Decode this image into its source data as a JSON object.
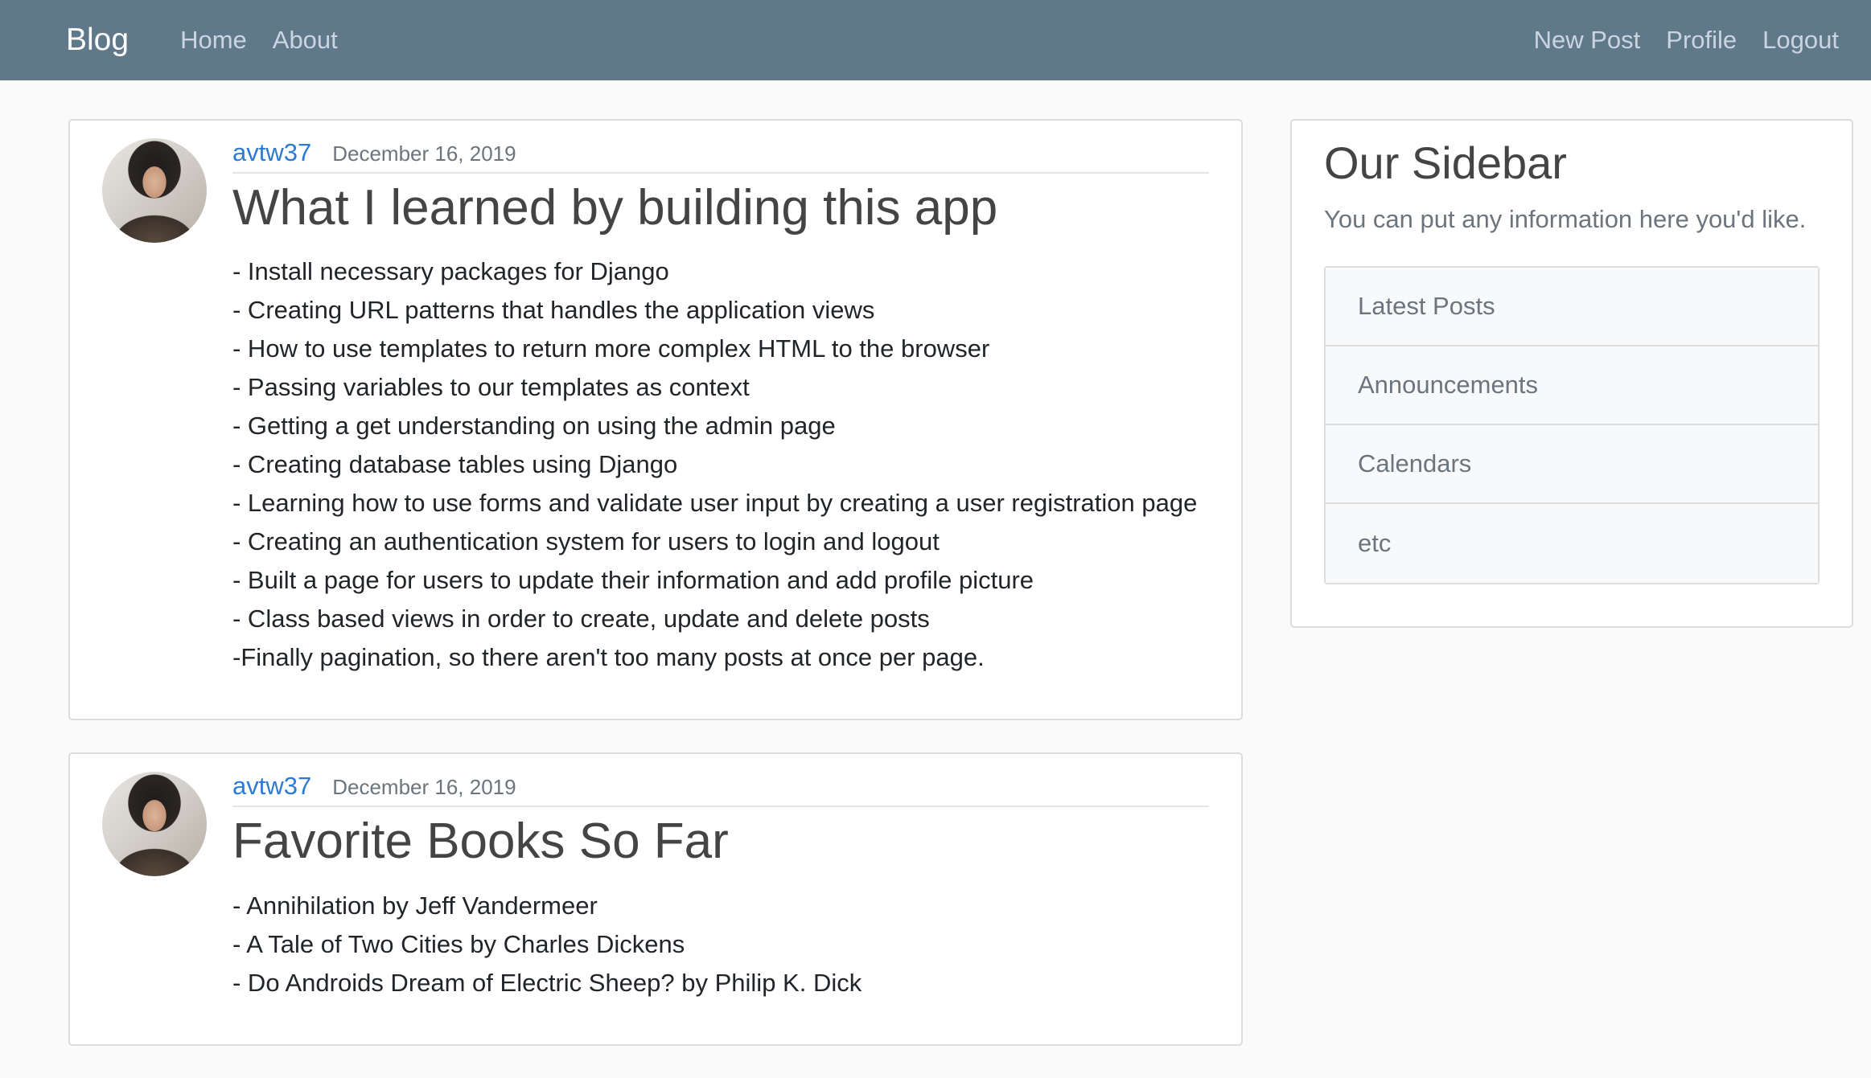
{
  "navbar": {
    "brand": "Blog",
    "left_links": [
      "Home",
      "About"
    ],
    "right_links": [
      "New Post",
      "Profile",
      "Logout"
    ],
    "background_color": "#5f788a"
  },
  "posts": [
    {
      "author": "avtw37",
      "date": "December 16, 2019",
      "title": "What I learned by building this app",
      "lines": [
        "- Install necessary packages for Django",
        "- Creating URL patterns that handles the application views",
        "- How to use templates to return more complex HTML to the browser",
        "- Passing variables to our templates as context",
        "- Getting a get understanding on using the admin page",
        "- Creating database tables using Django",
        "- Learning how to use forms and validate user input by creating a user registration page",
        "- Creating an authentication system for users to login and logout",
        "- Built a page for users to update their information and add profile picture",
        "- Class based views in order to create, update and delete posts",
        "-Finally pagination, so there aren't too many posts at once per page."
      ]
    },
    {
      "author": "avtw37",
      "date": "December 16, 2019",
      "title": "Favorite Books So Far",
      "lines": [
        "- Annihilation by Jeff Vandermeer",
        "- A Tale of Two Cities by Charles Dickens",
        "- Do Androids Dream of Electric Sheep? by Philip K. Dick"
      ]
    }
  ],
  "sidebar": {
    "title": "Our Sidebar",
    "description": "You can put any information here you'd like.",
    "items": [
      "Latest Posts",
      "Announcements",
      "Calendars",
      "etc"
    ]
  },
  "colors": {
    "author_link": "#2b7bd6",
    "page_background": "#fafafa"
  }
}
